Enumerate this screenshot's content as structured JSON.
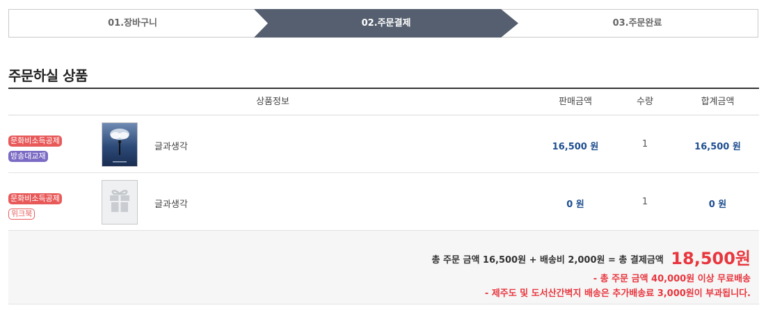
{
  "steps": {
    "step1": "01.장바구니",
    "step2": "02.주문결제",
    "step3": "03.주문완료",
    "active_color": "#555f6f"
  },
  "section_title": "주문하실 상품",
  "table": {
    "headers": {
      "info": "상품정보",
      "price": "판매금액",
      "qty": "수량",
      "total": "합계금액"
    },
    "rows": [
      {
        "badges": [
          "문화비소득공제",
          "방송대교재"
        ],
        "thumb": "book-cover-image",
        "name": "글과생각",
        "price": "16,500 원",
        "qty": "1",
        "total": "16,500 원"
      },
      {
        "badges": [
          "문화비소득공제",
          "위크북"
        ],
        "thumb": "gift-icon",
        "name": "글과생각",
        "price": "0 원",
        "qty": "1",
        "total": "0 원"
      }
    ]
  },
  "summary": {
    "formula": "총 주문 금액 16,500원 + 배송비 2,000원 = 총 결제금액",
    "grand_total": "18,500원",
    "note1": "- 총 주문 금액 40,000원 이상 무료배송",
    "note2": "- 제주도 및 도서산간벽지 배송은 추가배송료 3,000원이 부과됩니다."
  },
  "colors": {
    "accent_red": "#e8363e",
    "price_blue": "#1d4d8f",
    "badge_red": "#e85a5a",
    "badge_purple": "#7b6bc4"
  }
}
